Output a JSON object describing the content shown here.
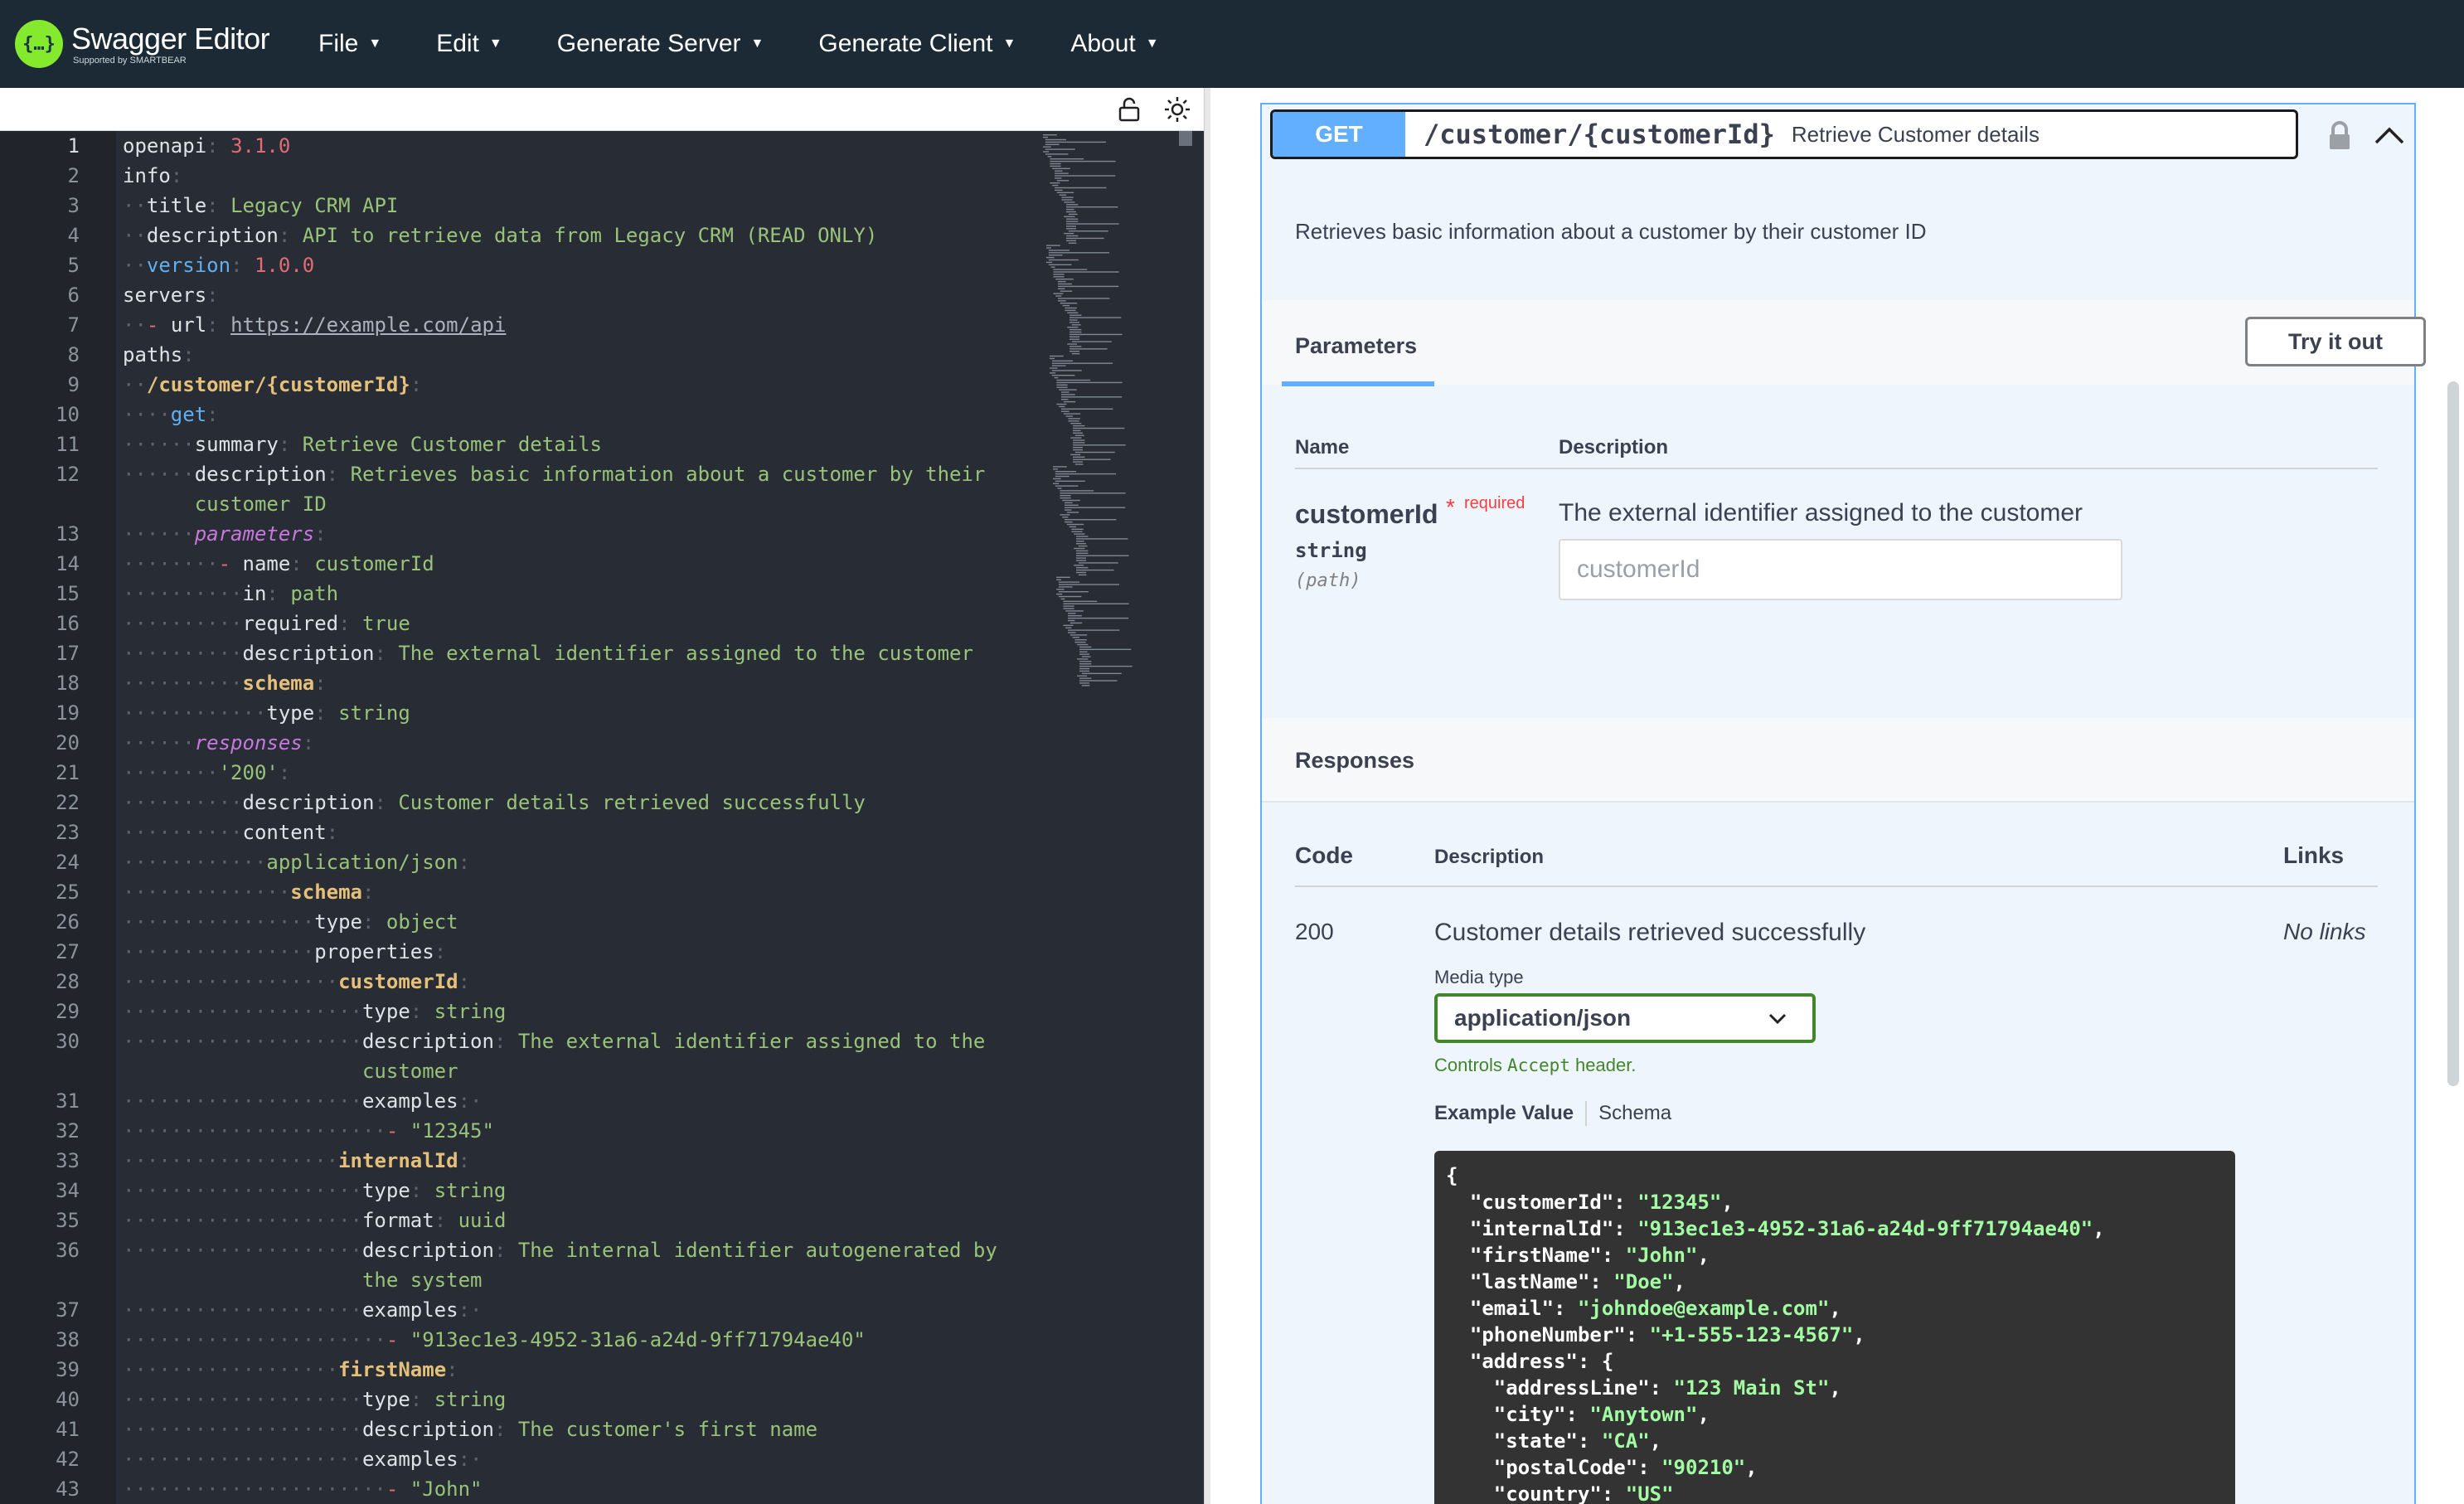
{
  "app": {
    "title": "Swagger Editor",
    "subtitle": "Supported by SMARTBEAR",
    "menu": [
      "File",
      "Edit",
      "Generate Server",
      "Generate Client",
      "About"
    ]
  },
  "editor": {
    "lines": [
      {
        "n": "1",
        "segs": [
          {
            "t": "openapi",
            "c": "k"
          },
          {
            "t": ": ",
            "c": "d"
          },
          {
            "t": "3.1.0",
            "c": "c"
          }
        ]
      },
      {
        "n": "2",
        "segs": [
          {
            "t": "info",
            "c": "k"
          },
          {
            "t": ":",
            "c": "d"
          }
        ]
      },
      {
        "n": "3",
        "segs": [
          {
            "t": "··",
            "c": "d"
          },
          {
            "t": "title",
            "c": "k"
          },
          {
            "t": ": ",
            "c": "d"
          },
          {
            "t": "Legacy CRM API",
            "c": "s"
          }
        ]
      },
      {
        "n": "4",
        "segs": [
          {
            "t": "··",
            "c": "d"
          },
          {
            "t": "description",
            "c": "k"
          },
          {
            "t": ": ",
            "c": "d"
          },
          {
            "t": "API to retrieve data from Legacy CRM (READ ONLY)",
            "c": "s"
          }
        ]
      },
      {
        "n": "5",
        "segs": [
          {
            "t": "··",
            "c": "d"
          },
          {
            "t": "version",
            "c": "kb"
          },
          {
            "t": ": ",
            "c": "d"
          },
          {
            "t": "1.0.0",
            "c": "c"
          }
        ]
      },
      {
        "n": "6",
        "segs": [
          {
            "t": "servers",
            "c": "k"
          },
          {
            "t": ":",
            "c": "d"
          }
        ]
      },
      {
        "n": "7",
        "segs": [
          {
            "t": "··",
            "c": "d"
          },
          {
            "t": "- ",
            "c": "c"
          },
          {
            "t": "url",
            "c": "k"
          },
          {
            "t": ": ",
            "c": "d"
          },
          {
            "t": "https://example.com/api",
            "c": "u"
          }
        ]
      },
      {
        "n": "8",
        "segs": [
          {
            "t": "paths",
            "c": "k"
          },
          {
            "t": ":",
            "c": "d"
          }
        ]
      },
      {
        "n": "9",
        "segs": [
          {
            "t": "··",
            "c": "d"
          },
          {
            "t": "/customer/{customerId}",
            "c": "kw"
          },
          {
            "t": ":",
            "c": "d"
          }
        ]
      },
      {
        "n": "10",
        "segs": [
          {
            "t": "····",
            "c": "d"
          },
          {
            "t": "get",
            "c": "kb"
          },
          {
            "t": ":",
            "c": "d"
          }
        ]
      },
      {
        "n": "11",
        "segs": [
          {
            "t": "······",
            "c": "d"
          },
          {
            "t": "summary",
            "c": "k"
          },
          {
            "t": ": ",
            "c": "d"
          },
          {
            "t": "Retrieve Customer details",
            "c": "s"
          }
        ]
      },
      {
        "n": "12",
        "segs": [
          {
            "t": "······",
            "c": "d"
          },
          {
            "t": "description",
            "c": "k"
          },
          {
            "t": ": ",
            "c": "d"
          },
          {
            "t": "Retrieves basic information about a customer by their",
            "c": "s"
          }
        ]
      },
      {
        "n": "",
        "segs": [
          {
            "t": "      ",
            "c": "d"
          },
          {
            "t": "customer ID",
            "c": "s"
          }
        ]
      },
      {
        "n": "13",
        "segs": [
          {
            "t": "······",
            "c": "d"
          },
          {
            "t": "parameters",
            "c": "kp"
          },
          {
            "t": ":",
            "c": "d"
          }
        ]
      },
      {
        "n": "14",
        "segs": [
          {
            "t": "········",
            "c": "d"
          },
          {
            "t": "- ",
            "c": "c"
          },
          {
            "t": "name",
            "c": "k"
          },
          {
            "t": ": ",
            "c": "d"
          },
          {
            "t": "customerId",
            "c": "s"
          }
        ]
      },
      {
        "n": "15",
        "segs": [
          {
            "t": "··········",
            "c": "d"
          },
          {
            "t": "in",
            "c": "k"
          },
          {
            "t": ": ",
            "c": "d"
          },
          {
            "t": "path",
            "c": "s"
          }
        ]
      },
      {
        "n": "16",
        "segs": [
          {
            "t": "··········",
            "c": "d"
          },
          {
            "t": "required",
            "c": "k"
          },
          {
            "t": ": ",
            "c": "d"
          },
          {
            "t": "true",
            "c": "s"
          }
        ]
      },
      {
        "n": "17",
        "segs": [
          {
            "t": "··········",
            "c": "d"
          },
          {
            "t": "description",
            "c": "k"
          },
          {
            "t": ": ",
            "c": "d"
          },
          {
            "t": "The external identifier assigned to the customer",
            "c": "s"
          }
        ]
      },
      {
        "n": "18",
        "segs": [
          {
            "t": "··········",
            "c": "d"
          },
          {
            "t": "schema",
            "c": "kw"
          },
          {
            "t": ":",
            "c": "d"
          }
        ]
      },
      {
        "n": "19",
        "segs": [
          {
            "t": "············",
            "c": "d"
          },
          {
            "t": "type",
            "c": "k"
          },
          {
            "t": ": ",
            "c": "d"
          },
          {
            "t": "string",
            "c": "s"
          }
        ]
      },
      {
        "n": "20",
        "segs": [
          {
            "t": "······",
            "c": "d"
          },
          {
            "t": "responses",
            "c": "kp"
          },
          {
            "t": ":",
            "c": "d"
          }
        ]
      },
      {
        "n": "21",
        "segs": [
          {
            "t": "········",
            "c": "d"
          },
          {
            "t": "'200'",
            "c": "s"
          },
          {
            "t": ":",
            "c": "d"
          }
        ]
      },
      {
        "n": "22",
        "segs": [
          {
            "t": "··········",
            "c": "d"
          },
          {
            "t": "description",
            "c": "k"
          },
          {
            "t": ": ",
            "c": "d"
          },
          {
            "t": "Customer details retrieved successfully",
            "c": "s"
          }
        ]
      },
      {
        "n": "23",
        "segs": [
          {
            "t": "··········",
            "c": "d"
          },
          {
            "t": "content",
            "c": "k"
          },
          {
            "t": ":",
            "c": "d"
          }
        ]
      },
      {
        "n": "24",
        "segs": [
          {
            "t": "············",
            "c": "d"
          },
          {
            "t": "application/json",
            "c": "s"
          },
          {
            "t": ":",
            "c": "d"
          }
        ]
      },
      {
        "n": "25",
        "segs": [
          {
            "t": "··············",
            "c": "d"
          },
          {
            "t": "schema",
            "c": "kw"
          },
          {
            "t": ":",
            "c": "d"
          }
        ]
      },
      {
        "n": "26",
        "segs": [
          {
            "t": "················",
            "c": "d"
          },
          {
            "t": "type",
            "c": "k"
          },
          {
            "t": ": ",
            "c": "d"
          },
          {
            "t": "object",
            "c": "s"
          }
        ]
      },
      {
        "n": "27",
        "segs": [
          {
            "t": "················",
            "c": "d"
          },
          {
            "t": "properties",
            "c": "k"
          },
          {
            "t": ":",
            "c": "d"
          }
        ]
      },
      {
        "n": "28",
        "segs": [
          {
            "t": "··················",
            "c": "d"
          },
          {
            "t": "customerId",
            "c": "kw"
          },
          {
            "t": ":",
            "c": "d"
          }
        ]
      },
      {
        "n": "29",
        "segs": [
          {
            "t": "····················",
            "c": "d"
          },
          {
            "t": "type",
            "c": "k"
          },
          {
            "t": ": ",
            "c": "d"
          },
          {
            "t": "string",
            "c": "s"
          }
        ]
      },
      {
        "n": "30",
        "segs": [
          {
            "t": "····················",
            "c": "d"
          },
          {
            "t": "description",
            "c": "k"
          },
          {
            "t": ": ",
            "c": "d"
          },
          {
            "t": "The external identifier assigned to the",
            "c": "s"
          }
        ]
      },
      {
        "n": "",
        "segs": [
          {
            "t": "                    ",
            "c": "d"
          },
          {
            "t": "customer",
            "c": "s"
          }
        ]
      },
      {
        "n": "31",
        "segs": [
          {
            "t": "····················",
            "c": "d"
          },
          {
            "t": "examples",
            "c": "k"
          },
          {
            "t": ":·",
            "c": "d"
          }
        ]
      },
      {
        "n": "32",
        "segs": [
          {
            "t": "······················",
            "c": "d"
          },
          {
            "t": "- ",
            "c": "c"
          },
          {
            "t": "\"12345\"",
            "c": "s"
          }
        ]
      },
      {
        "n": "33",
        "segs": [
          {
            "t": "··················",
            "c": "d"
          },
          {
            "t": "internalId",
            "c": "kw"
          },
          {
            "t": ":",
            "c": "d"
          }
        ]
      },
      {
        "n": "34",
        "segs": [
          {
            "t": "····················",
            "c": "d"
          },
          {
            "t": "type",
            "c": "k"
          },
          {
            "t": ": ",
            "c": "d"
          },
          {
            "t": "string",
            "c": "s"
          }
        ]
      },
      {
        "n": "35",
        "segs": [
          {
            "t": "····················",
            "c": "d"
          },
          {
            "t": "format",
            "c": "k"
          },
          {
            "t": ": ",
            "c": "d"
          },
          {
            "t": "uuid",
            "c": "s"
          }
        ]
      },
      {
        "n": "36",
        "segs": [
          {
            "t": "····················",
            "c": "d"
          },
          {
            "t": "description",
            "c": "k"
          },
          {
            "t": ": ",
            "c": "d"
          },
          {
            "t": "The internal identifier autogenerated by",
            "c": "s"
          }
        ]
      },
      {
        "n": "",
        "segs": [
          {
            "t": "                    ",
            "c": "d"
          },
          {
            "t": "the system",
            "c": "s"
          }
        ]
      },
      {
        "n": "37",
        "segs": [
          {
            "t": "····················",
            "c": "d"
          },
          {
            "t": "examples",
            "c": "k"
          },
          {
            "t": ":·",
            "c": "d"
          }
        ]
      },
      {
        "n": "38",
        "segs": [
          {
            "t": "······················",
            "c": "d"
          },
          {
            "t": "- ",
            "c": "c"
          },
          {
            "t": "\"913ec1e3-4952-31a6-a24d-9ff71794ae40\"",
            "c": "s"
          }
        ]
      },
      {
        "n": "39",
        "segs": [
          {
            "t": "··················",
            "c": "d"
          },
          {
            "t": "firstName",
            "c": "kw"
          },
          {
            "t": ":",
            "c": "d"
          }
        ]
      },
      {
        "n": "40",
        "segs": [
          {
            "t": "····················",
            "c": "d"
          },
          {
            "t": "type",
            "c": "k"
          },
          {
            "t": ": ",
            "c": "d"
          },
          {
            "t": "string",
            "c": "s"
          }
        ]
      },
      {
        "n": "41",
        "segs": [
          {
            "t": "····················",
            "c": "d"
          },
          {
            "t": "description",
            "c": "k"
          },
          {
            "t": ": ",
            "c": "d"
          },
          {
            "t": "The customer's first name",
            "c": "s"
          }
        ]
      },
      {
        "n": "42",
        "segs": [
          {
            "t": "····················",
            "c": "d"
          },
          {
            "t": "examples",
            "c": "k"
          },
          {
            "t": ":·",
            "c": "d"
          }
        ]
      },
      {
        "n": "43",
        "segs": [
          {
            "t": "······················",
            "c": "d"
          },
          {
            "t": "- ",
            "c": "c"
          },
          {
            "t": "\"John\"",
            "c": "s"
          }
        ]
      }
    ]
  },
  "operation": {
    "method": "GET",
    "path": "/customer/{customerId}",
    "summary": "Retrieve Customer details",
    "description": "Retrieves basic information about a customer by their customer ID"
  },
  "parameters": {
    "tab": "Parameters",
    "try_label": "Try it out",
    "col_name": "Name",
    "col_desc": "Description",
    "param": {
      "name": "customerId",
      "star": "*",
      "required": "required",
      "type": "string",
      "in": "(path)",
      "description": "The external identifier assigned to the customer",
      "placeholder": "customerId"
    }
  },
  "responses": {
    "title": "Responses",
    "col_code": "Code",
    "col_desc": "Description",
    "col_links": "Links",
    "row": {
      "code": "200",
      "description": "Customer details retrieved successfully",
      "links": "No links"
    },
    "media_type_label": "Media type",
    "media_type": "application/json",
    "note_prefix": "Controls ",
    "note_code": "Accept",
    "note_suffix": " header.",
    "tab_example": "Example Value",
    "tab_schema": "Schema",
    "example": [
      [
        {
          "t": "{",
          "c": ""
        }
      ],
      [
        {
          "t": "  \"customerId\": ",
          "c": ""
        },
        {
          "t": "\"12345\"",
          "c": "js"
        },
        {
          "t": ",",
          "c": ""
        }
      ],
      [
        {
          "t": "  \"internalId\": ",
          "c": ""
        },
        {
          "t": "\"913ec1e3-4952-31a6-a24d-9ff71794ae40\"",
          "c": "js"
        },
        {
          "t": ",",
          "c": ""
        }
      ],
      [
        {
          "t": "  \"firstName\": ",
          "c": ""
        },
        {
          "t": "\"John\"",
          "c": "js"
        },
        {
          "t": ",",
          "c": ""
        }
      ],
      [
        {
          "t": "  \"lastName\": ",
          "c": ""
        },
        {
          "t": "\"Doe\"",
          "c": "js"
        },
        {
          "t": ",",
          "c": ""
        }
      ],
      [
        {
          "t": "  \"email\": ",
          "c": ""
        },
        {
          "t": "\"johndoe@example.com\"",
          "c": "js"
        },
        {
          "t": ",",
          "c": ""
        }
      ],
      [
        {
          "t": "  \"phoneNumber\": ",
          "c": ""
        },
        {
          "t": "\"+1-555-123-4567\"",
          "c": "js"
        },
        {
          "t": ",",
          "c": ""
        }
      ],
      [
        {
          "t": "  \"address\": {",
          "c": ""
        }
      ],
      [
        {
          "t": "    \"addressLine\": ",
          "c": ""
        },
        {
          "t": "\"123 Main St\"",
          "c": "js"
        },
        {
          "t": ",",
          "c": ""
        }
      ],
      [
        {
          "t": "    \"city\": ",
          "c": ""
        },
        {
          "t": "\"Anytown\"",
          "c": "js"
        },
        {
          "t": ",",
          "c": ""
        }
      ],
      [
        {
          "t": "    \"state\": ",
          "c": ""
        },
        {
          "t": "\"CA\"",
          "c": "js"
        },
        {
          "t": ",",
          "c": ""
        }
      ],
      [
        {
          "t": "    \"postalCode\": ",
          "c": ""
        },
        {
          "t": "\"90210\"",
          "c": "js"
        },
        {
          "t": ",",
          "c": ""
        }
      ],
      [
        {
          "t": "    \"country\": ",
          "c": ""
        },
        {
          "t": "\"US\"",
          "c": "js"
        }
      ]
    ]
  },
  "colors": {
    "get": "#61affe",
    "topbar": "#1b2a35",
    "editor_bg": "#282c34",
    "accent_green": "#41862b",
    "required_red": "#f93e3e"
  },
  "icons": [
    "swagger-logo-icon",
    "lock-open-icon",
    "sun-icon",
    "lock-icon",
    "chevron-up-icon",
    "chevron-down-icon"
  ]
}
